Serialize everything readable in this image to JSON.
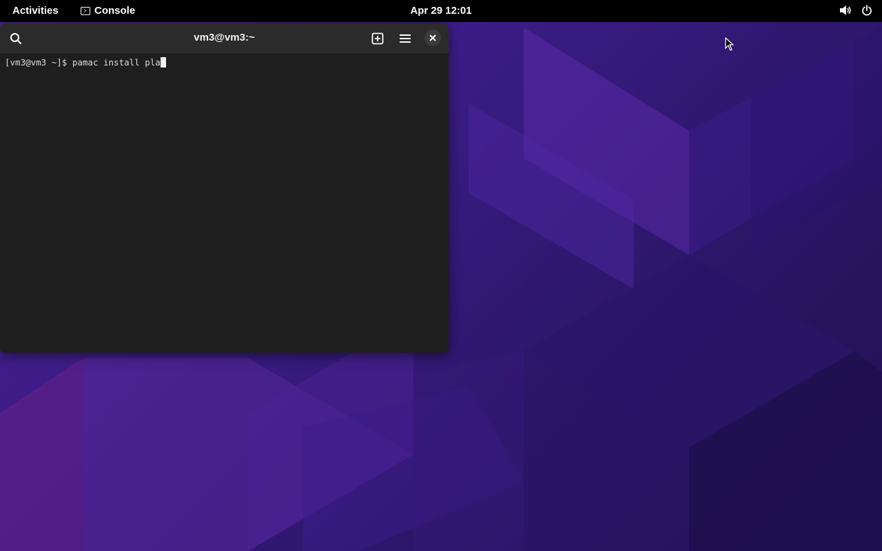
{
  "topbar": {
    "activities_label": "Activities",
    "app_name": "Console",
    "clock": "Apr 29  12:01"
  },
  "window": {
    "title": "vm3@vm3:~"
  },
  "terminal": {
    "prompt": "[vm3@vm3 ~]$ ",
    "command": "pamac install pla"
  },
  "colors": {
    "topbar_bg": "#000000",
    "terminal_bg": "#1e1e1e",
    "headerbar_bg": "#2b2b2b",
    "wallpaper_accent": "#4a1f8f"
  },
  "icons": {
    "search": "search-icon",
    "new_tab": "new-tab-icon",
    "menu": "hamburger-menu-icon",
    "close": "close-icon",
    "volume": "volume-icon",
    "power": "power-icon"
  }
}
